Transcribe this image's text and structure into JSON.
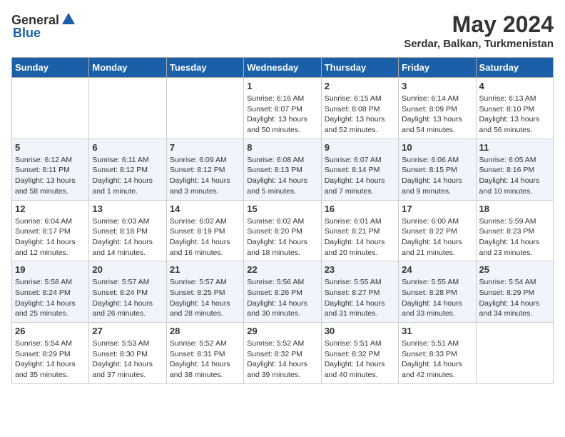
{
  "logo": {
    "general": "General",
    "blue": "Blue"
  },
  "title": "May 2024",
  "location": "Serdar, Balkan, Turkmenistan",
  "days_of_week": [
    "Sunday",
    "Monday",
    "Tuesday",
    "Wednesday",
    "Thursday",
    "Friday",
    "Saturday"
  ],
  "weeks": [
    [
      {
        "day": "",
        "info": ""
      },
      {
        "day": "",
        "info": ""
      },
      {
        "day": "",
        "info": ""
      },
      {
        "day": "1",
        "sunrise": "Sunrise: 6:16 AM",
        "sunset": "Sunset: 8:07 PM",
        "daylight": "Daylight: 13 hours and 50 minutes."
      },
      {
        "day": "2",
        "sunrise": "Sunrise: 6:15 AM",
        "sunset": "Sunset: 8:08 PM",
        "daylight": "Daylight: 13 hours and 52 minutes."
      },
      {
        "day": "3",
        "sunrise": "Sunrise: 6:14 AM",
        "sunset": "Sunset: 8:09 PM",
        "daylight": "Daylight: 13 hours and 54 minutes."
      },
      {
        "day": "4",
        "sunrise": "Sunrise: 6:13 AM",
        "sunset": "Sunset: 8:10 PM",
        "daylight": "Daylight: 13 hours and 56 minutes."
      }
    ],
    [
      {
        "day": "5",
        "sunrise": "Sunrise: 6:12 AM",
        "sunset": "Sunset: 8:11 PM",
        "daylight": "Daylight: 13 hours and 58 minutes."
      },
      {
        "day": "6",
        "sunrise": "Sunrise: 6:11 AM",
        "sunset": "Sunset: 8:12 PM",
        "daylight": "Daylight: 14 hours and 1 minute."
      },
      {
        "day": "7",
        "sunrise": "Sunrise: 6:09 AM",
        "sunset": "Sunset: 8:12 PM",
        "daylight": "Daylight: 14 hours and 3 minutes."
      },
      {
        "day": "8",
        "sunrise": "Sunrise: 6:08 AM",
        "sunset": "Sunset: 8:13 PM",
        "daylight": "Daylight: 14 hours and 5 minutes."
      },
      {
        "day": "9",
        "sunrise": "Sunrise: 6:07 AM",
        "sunset": "Sunset: 8:14 PM",
        "daylight": "Daylight: 14 hours and 7 minutes."
      },
      {
        "day": "10",
        "sunrise": "Sunrise: 6:06 AM",
        "sunset": "Sunset: 8:15 PM",
        "daylight": "Daylight: 14 hours and 9 minutes."
      },
      {
        "day": "11",
        "sunrise": "Sunrise: 6:05 AM",
        "sunset": "Sunset: 8:16 PM",
        "daylight": "Daylight: 14 hours and 10 minutes."
      }
    ],
    [
      {
        "day": "12",
        "sunrise": "Sunrise: 6:04 AM",
        "sunset": "Sunset: 8:17 PM",
        "daylight": "Daylight: 14 hours and 12 minutes."
      },
      {
        "day": "13",
        "sunrise": "Sunrise: 6:03 AM",
        "sunset": "Sunset: 8:18 PM",
        "daylight": "Daylight: 14 hours and 14 minutes."
      },
      {
        "day": "14",
        "sunrise": "Sunrise: 6:02 AM",
        "sunset": "Sunset: 8:19 PM",
        "daylight": "Daylight: 14 hours and 16 minutes."
      },
      {
        "day": "15",
        "sunrise": "Sunrise: 6:02 AM",
        "sunset": "Sunset: 8:20 PM",
        "daylight": "Daylight: 14 hours and 18 minutes."
      },
      {
        "day": "16",
        "sunrise": "Sunrise: 6:01 AM",
        "sunset": "Sunset: 8:21 PM",
        "daylight": "Daylight: 14 hours and 20 minutes."
      },
      {
        "day": "17",
        "sunrise": "Sunrise: 6:00 AM",
        "sunset": "Sunset: 8:22 PM",
        "daylight": "Daylight: 14 hours and 21 minutes."
      },
      {
        "day": "18",
        "sunrise": "Sunrise: 5:59 AM",
        "sunset": "Sunset: 8:23 PM",
        "daylight": "Daylight: 14 hours and 23 minutes."
      }
    ],
    [
      {
        "day": "19",
        "sunrise": "Sunrise: 5:58 AM",
        "sunset": "Sunset: 8:24 PM",
        "daylight": "Daylight: 14 hours and 25 minutes."
      },
      {
        "day": "20",
        "sunrise": "Sunrise: 5:57 AM",
        "sunset": "Sunset: 8:24 PM",
        "daylight": "Daylight: 14 hours and 26 minutes."
      },
      {
        "day": "21",
        "sunrise": "Sunrise: 5:57 AM",
        "sunset": "Sunset: 8:25 PM",
        "daylight": "Daylight: 14 hours and 28 minutes."
      },
      {
        "day": "22",
        "sunrise": "Sunrise: 5:56 AM",
        "sunset": "Sunset: 8:26 PM",
        "daylight": "Daylight: 14 hours and 30 minutes."
      },
      {
        "day": "23",
        "sunrise": "Sunrise: 5:55 AM",
        "sunset": "Sunset: 8:27 PM",
        "daylight": "Daylight: 14 hours and 31 minutes."
      },
      {
        "day": "24",
        "sunrise": "Sunrise: 5:55 AM",
        "sunset": "Sunset: 8:28 PM",
        "daylight": "Daylight: 14 hours and 33 minutes."
      },
      {
        "day": "25",
        "sunrise": "Sunrise: 5:54 AM",
        "sunset": "Sunset: 8:29 PM",
        "daylight": "Daylight: 14 hours and 34 minutes."
      }
    ],
    [
      {
        "day": "26",
        "sunrise": "Sunrise: 5:54 AM",
        "sunset": "Sunset: 8:29 PM",
        "daylight": "Daylight: 14 hours and 35 minutes."
      },
      {
        "day": "27",
        "sunrise": "Sunrise: 5:53 AM",
        "sunset": "Sunset: 8:30 PM",
        "daylight": "Daylight: 14 hours and 37 minutes."
      },
      {
        "day": "28",
        "sunrise": "Sunrise: 5:52 AM",
        "sunset": "Sunset: 8:31 PM",
        "daylight": "Daylight: 14 hours and 38 minutes."
      },
      {
        "day": "29",
        "sunrise": "Sunrise: 5:52 AM",
        "sunset": "Sunset: 8:32 PM",
        "daylight": "Daylight: 14 hours and 39 minutes."
      },
      {
        "day": "30",
        "sunrise": "Sunrise: 5:51 AM",
        "sunset": "Sunset: 8:32 PM",
        "daylight": "Daylight: 14 hours and 40 minutes."
      },
      {
        "day": "31",
        "sunrise": "Sunrise: 5:51 AM",
        "sunset": "Sunset: 8:33 PM",
        "daylight": "Daylight: 14 hours and 42 minutes."
      },
      {
        "day": "",
        "info": ""
      }
    ]
  ]
}
